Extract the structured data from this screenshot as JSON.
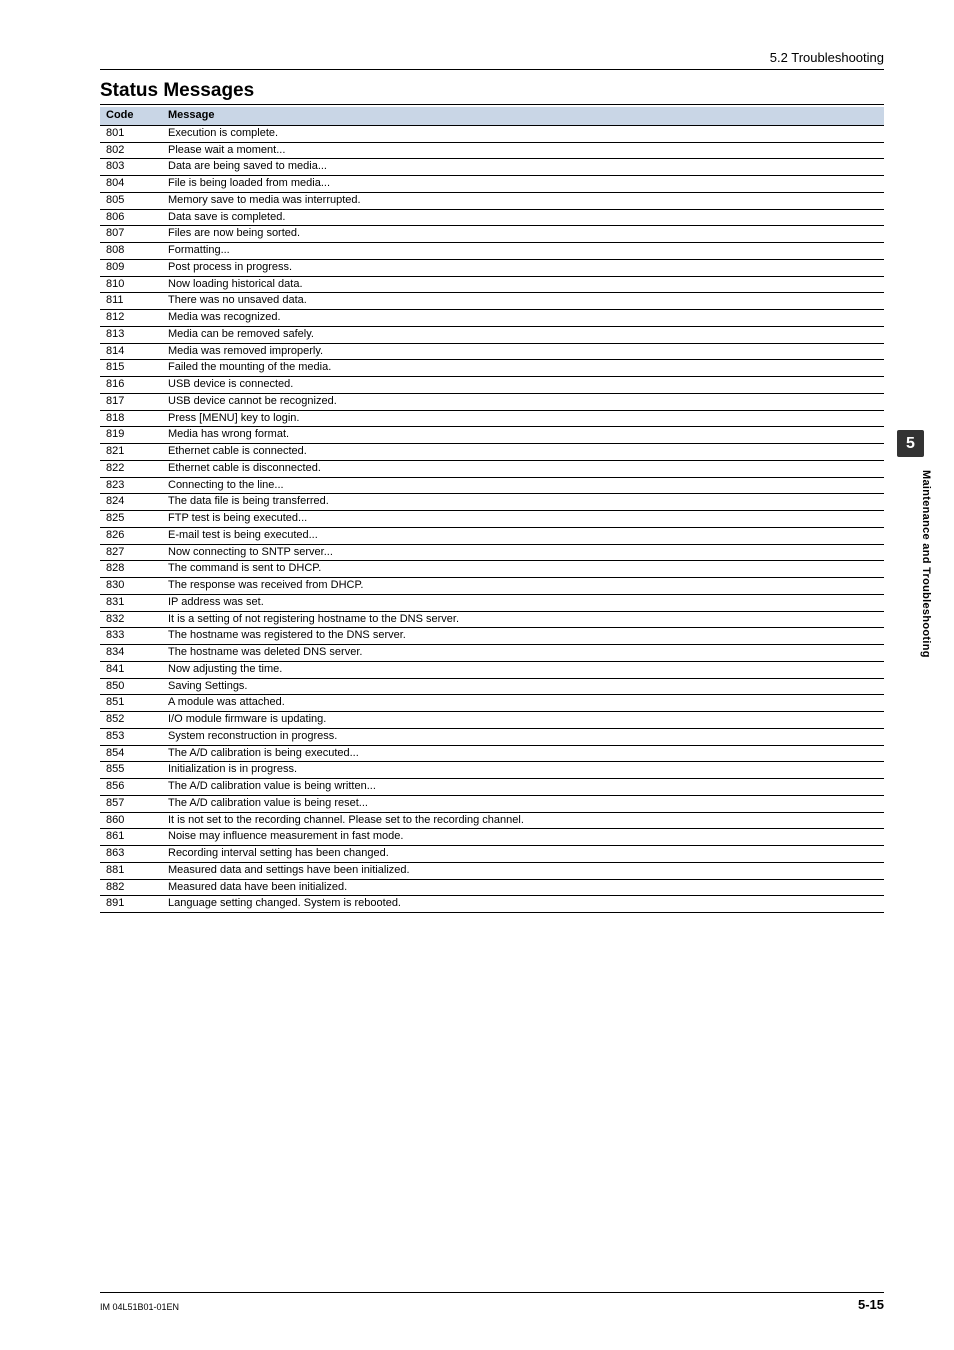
{
  "header": {
    "breadcrumb": "5.2  Troubleshooting"
  },
  "section_title": "Status Messages",
  "table": {
    "head_code": "Code",
    "head_msg": "Message",
    "rows": [
      {
        "code": "801",
        "msg": "Execution is complete."
      },
      {
        "code": "802",
        "msg": "Please wait a moment..."
      },
      {
        "code": "803",
        "msg": "Data are being saved to media..."
      },
      {
        "code": "804",
        "msg": "File is being loaded from media..."
      },
      {
        "code": "805",
        "msg": "Memory save to media was interrupted."
      },
      {
        "code": "806",
        "msg": "Data save is completed."
      },
      {
        "code": "807",
        "msg": "Files are now being sorted."
      },
      {
        "code": "808",
        "msg": "Formatting..."
      },
      {
        "code": "809",
        "msg": "Post process in progress."
      },
      {
        "code": "810",
        "msg": "Now loading historical data."
      },
      {
        "code": "811",
        "msg": "There was no unsaved data."
      },
      {
        "code": "812",
        "msg": "Media was recognized."
      },
      {
        "code": "813",
        "msg": "Media can be removed safely."
      },
      {
        "code": "814",
        "msg": "Media was removed improperly."
      },
      {
        "code": "815",
        "msg": "Failed the mounting of the media."
      },
      {
        "code": "816",
        "msg": "USB device is connected."
      },
      {
        "code": "817",
        "msg": "USB device cannot be recognized."
      },
      {
        "code": "818",
        "msg": "Press [MENU] key to login."
      },
      {
        "code": "819",
        "msg": "Media has wrong format."
      },
      {
        "code": "821",
        "msg": "Ethernet cable is connected."
      },
      {
        "code": "822",
        "msg": "Ethernet cable is disconnected."
      },
      {
        "code": "823",
        "msg": "Connecting to the line..."
      },
      {
        "code": "824",
        "msg": "The data file is being transferred."
      },
      {
        "code": "825",
        "msg": "FTP test is being executed..."
      },
      {
        "code": "826",
        "msg": "E-mail test is being executed..."
      },
      {
        "code": "827",
        "msg": "Now connecting to SNTP server..."
      },
      {
        "code": "828",
        "msg": "The command is sent to DHCP."
      },
      {
        "code": "830",
        "msg": "The response was received from DHCP."
      },
      {
        "code": "831",
        "msg": "IP address was set."
      },
      {
        "code": "832",
        "msg": "It is a setting of not registering hostname to the DNS server."
      },
      {
        "code": "833",
        "msg": "The hostname was registered to the DNS server."
      },
      {
        "code": "834",
        "msg": "The hostname was deleted DNS server."
      },
      {
        "code": "841",
        "msg": "Now adjusting the time."
      },
      {
        "code": "850",
        "msg": "Saving Settings."
      },
      {
        "code": "851",
        "msg": "A module was attached."
      },
      {
        "code": "852",
        "msg": "I/O module firmware is updating."
      },
      {
        "code": "853",
        "msg": "System reconstruction in progress."
      },
      {
        "code": "854",
        "msg": "The A/D calibration is being executed..."
      },
      {
        "code": "855",
        "msg": "Initialization is in progress."
      },
      {
        "code": "856",
        "msg": "The A/D calibration value is being written..."
      },
      {
        "code": "857",
        "msg": "The A/D calibration value is being reset..."
      },
      {
        "code": "860",
        "msg": "It is not set to the recording channel. Please set to the recording channel."
      },
      {
        "code": "861",
        "msg": "Noise may influence measurement in fast mode."
      },
      {
        "code": "863",
        "msg": "Recording interval setting has been changed."
      },
      {
        "code": "881",
        "msg": "Measured data and settings have been initialized."
      },
      {
        "code": "882",
        "msg": "Measured data have been initialized."
      },
      {
        "code": "891",
        "msg": "Language setting changed. System is rebooted."
      }
    ]
  },
  "side": {
    "chapter_number": "5",
    "chapter_label": "Maintenance and Troubleshooting"
  },
  "footer": {
    "doc_id": "IM 04L51B01-01EN",
    "page_num": "5-15"
  }
}
